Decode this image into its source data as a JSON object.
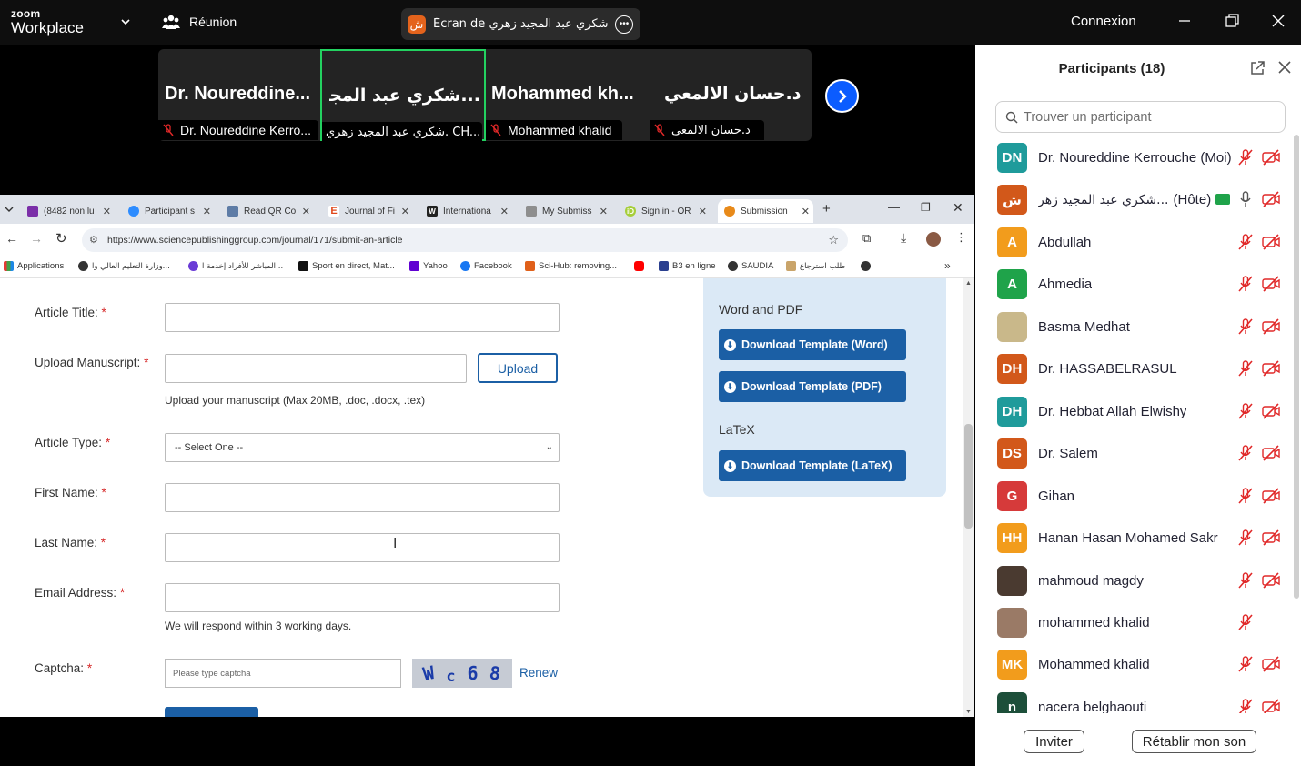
{
  "topbar": {
    "logo_line1": "zoom",
    "logo_line2": "Workplace",
    "meeting_label": "Réunion",
    "share_text": "Écran de شكري عبد المجيد زهري. C",
    "share_avatar": "ش",
    "signin": "Connexion"
  },
  "gallery": {
    "tiles": [
      {
        "name": "Dr.  Noureddine...",
        "label": "Dr. Noureddine Kerro..."
      },
      {
        "name": "...شكري عبد المجيد",
        "label": "شكري عبد المجيد زهري. CH..."
      },
      {
        "name": "Mohammed  kh...",
        "label": "Mohammed khalid"
      },
      {
        "name": "د.حسان الالمعي",
        "label": "د.حسان الالمعي"
      }
    ]
  },
  "participants": {
    "title": "Participants (18)",
    "search_placeholder": "Trouver un participant",
    "items": [
      {
        "initials": "DN",
        "name": "Dr. Noureddine Kerrouche (Moi)",
        "color": "#1f9b9b",
        "cam": true
      },
      {
        "initials": "ش",
        "name": "شكري عبد المجيد زهر...",
        "suffix": "(Hôte)",
        "color": "#d2581a",
        "cam": true
      },
      {
        "initials": "A",
        "name": "Abdullah",
        "color": "#f29c1c",
        "cam": true
      },
      {
        "initials": "A",
        "name": "Ahmedia",
        "color": "#1fa34a",
        "cam": true
      },
      {
        "initials": "",
        "name": "Basma Medhat",
        "color": "#c9b88a",
        "cam": true
      },
      {
        "initials": "DH",
        "name": "Dr. HASSABELRASUL",
        "color": "#d2581a",
        "cam": true
      },
      {
        "initials": "DH",
        "name": "Dr. Hebbat Allah  Elwishy",
        "color": "#1f9b9b",
        "cam": true
      },
      {
        "initials": "DS",
        "name": "Dr. Salem",
        "color": "#d2581a",
        "cam": true
      },
      {
        "initials": "G",
        "name": "Gihan",
        "color": "#d63a3a",
        "cam": true
      },
      {
        "initials": "HH",
        "name": "Hanan Hasan Mohamed Sakr",
        "color": "#f29c1c",
        "cam": true
      },
      {
        "initials": "",
        "name": "mahmoud magdy",
        "color": "#4a3a30",
        "cam": true
      },
      {
        "initials": "",
        "name": "mohammed khalid",
        "color": "#9a7a66",
        "cam": false
      },
      {
        "initials": "MK",
        "name": "Mohammed khalid",
        "color": "#f29c1c",
        "cam": true
      },
      {
        "initials": "n",
        "name": "nacera belghaouti",
        "color": "#1d4f3a",
        "cam": true
      }
    ],
    "invite": "Inviter",
    "unmute": "Rétablir mon son"
  },
  "browser": {
    "tabs": [
      {
        "label": "(8482 non lu",
        "color": "#7b2fa8"
      },
      {
        "label": "Participant s",
        "color": "#2d8cff"
      },
      {
        "label": "Read QR Co",
        "color": "#5e7ca6"
      },
      {
        "label": "Journal of Fi",
        "color": "#e0471b"
      },
      {
        "label": "Internationa",
        "color": "#222222"
      },
      {
        "label": "My Submiss",
        "color": "#8e8e8e"
      },
      {
        "label": "Sign in - OR",
        "color": "#a6ce39"
      },
      {
        "label": "Submission",
        "color": "#e88a1a"
      }
    ],
    "url": "https://www.sciencepublishinggroup.com/journal/171/submit-an-article",
    "bookmarks": [
      "Applications",
      "وزارة التعليم العالي وا...",
      "المباشر للأفراد إخدمة ا...",
      "Sport en direct, Mat...",
      "Yahoo",
      "Facebook",
      "Sci-Hub: removing...",
      "",
      "B3 en ligne",
      "SAUDIA",
      "طلب استرجاع",
      ""
    ]
  },
  "form": {
    "article_title": "Article Title:",
    "upload_manuscript": "Upload Manuscript:",
    "upload_btn": "Upload",
    "upload_hint": "Upload your manuscript (Max 20MB, .doc, .docx, .tex)",
    "article_type": "Article Type:",
    "type_default": "-- Select One --",
    "first_name": "First Name:",
    "last_name": "Last Name:",
    "email": "Email Address:",
    "email_hint": "We will respond within 3 working days.",
    "captcha": "Captcha:",
    "captcha_placeholder": "Please type captcha",
    "captcha_chars": [
      "W",
      "c",
      "6",
      "8"
    ],
    "renew": "Renew",
    "required_mark": "*"
  },
  "templates": {
    "word_pdf_heading": "Word and PDF",
    "btn_word": "Download Template (Word)",
    "btn_pdf": "Download Template (PDF)",
    "latex_heading": "LaTeX",
    "btn_latex": "Download Template (LaTeX)"
  }
}
